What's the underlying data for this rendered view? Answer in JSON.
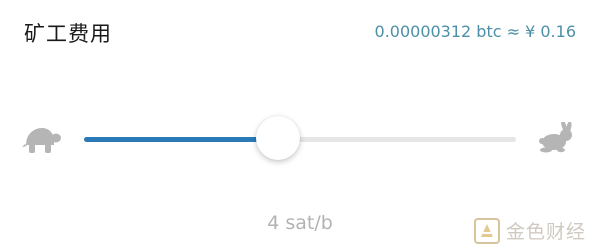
{
  "header": {
    "title": "矿工费用",
    "fee_readout": "0.00000312 btc ≈ ¥ 0.16"
  },
  "slider": {
    "value_fraction": 0.45,
    "rate_label": "4 sat/b",
    "slow_icon": "turtle-icon",
    "fast_icon": "rabbit-icon",
    "fill_color": "#2a7ab8",
    "track_color": "#e6e6e6"
  },
  "watermark": {
    "text": "金色财经"
  }
}
